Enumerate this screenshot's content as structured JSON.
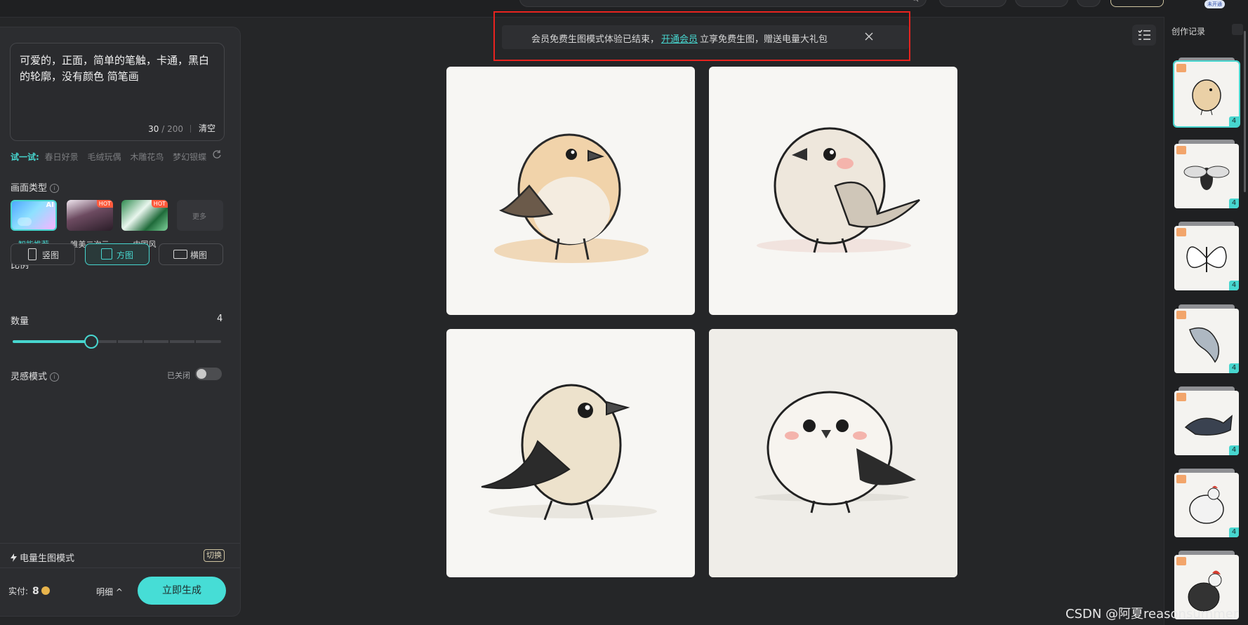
{
  "banner": {
    "text_before": "会员免费生图模式体验已结束，",
    "link": "开通会员",
    "text_after": "立享免费生图，赠送电量大礼包"
  },
  "prompt": {
    "text": "可爱的，正面，简单的笔触，卡通，黑白的轮廓，没有颜色 简笔画",
    "count": "30",
    "max": "/ 200",
    "clear": "清空"
  },
  "try": {
    "lead": "试一试:",
    "suggestions": [
      "春日好景",
      "毛绒玩偶",
      "木雕花鸟",
      "梦幻银蝶"
    ]
  },
  "style_section": {
    "title": "画面类型",
    "ai_badge": "AI",
    "hot_badge": "HOT",
    "more": "更多",
    "items": [
      "智能推荐",
      "唯美二次元",
      "中国风"
    ]
  },
  "ratio": {
    "title": "比例",
    "options": [
      "竖图",
      "方图",
      "横图"
    ],
    "selected": "方图"
  },
  "quantity": {
    "title": "数量",
    "value": "4",
    "fraction": 0.375
  },
  "inspiration": {
    "title": "灵感模式",
    "state": "已关闭"
  },
  "power": {
    "label": "电量生图模式",
    "switch": "切换"
  },
  "footer": {
    "cost_label": "实付:",
    "cost_value": "8",
    "detail": "明细",
    "generate": "立即生成"
  },
  "history": {
    "title": "创作记录",
    "count_badge": "4",
    "items": [
      "bird",
      "bee",
      "butterfly",
      "dolphin",
      "whale",
      "hen",
      "rooster"
    ]
  },
  "topbar": {
    "badge": "未开通"
  },
  "watermark": "CSDN @阿夏reasonsummer",
  "colors": {
    "accent": "#47d6cf",
    "highlight_box": "#e8231f",
    "background": "#252628"
  }
}
